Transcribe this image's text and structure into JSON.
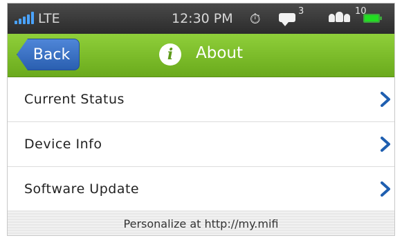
{
  "status_bar": {
    "network": "LTE",
    "time": "12:30 PM",
    "messages_count": "3",
    "users_count": "10",
    "icons": [
      "signal-icon",
      "stopwatch-icon",
      "message-icon",
      "users-icon",
      "battery-icon"
    ]
  },
  "header": {
    "back_label": "Back",
    "title": "About",
    "info_glyph": "i"
  },
  "list": {
    "items": [
      {
        "label": "Current Status"
      },
      {
        "label": "Device Info"
      },
      {
        "label": "Software Update"
      }
    ]
  },
  "footer": {
    "text": "Personalize at http://my.mifi"
  },
  "colors": {
    "header_green": "#7fbf2a",
    "back_blue": "#3a6fc4",
    "chevron_blue": "#1f5fb0",
    "battery_green": "#22dd22",
    "signal_blue": "#4aa3ff"
  }
}
